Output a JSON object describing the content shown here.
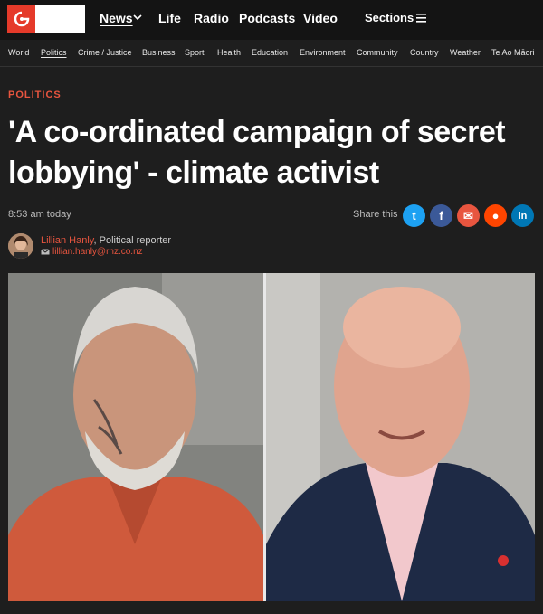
{
  "nav": {
    "items": [
      {
        "label": "News"
      },
      {
        "label": "Life"
      },
      {
        "label": "Radio"
      },
      {
        "label": "Podcasts"
      },
      {
        "label": "Video"
      }
    ],
    "sections_label": "Sections"
  },
  "subnav": {
    "items": [
      "World",
      "Politics",
      "Crime / Justice",
      "Business",
      "Sport",
      "Health",
      "Education",
      "Environment",
      "Community",
      "Country",
      "Weather",
      "Te Ao Māori"
    ]
  },
  "article": {
    "kicker": "POLITICS",
    "headline": "'A co-ordinated campaign of secret lobbying' - climate activist",
    "time": "8:53 am today",
    "share_label": "Share this",
    "share_buttons": [
      {
        "icon": "twitter-icon",
        "glyph": "t",
        "color": "#1da1f2"
      },
      {
        "icon": "facebook-icon",
        "glyph": "f",
        "color": "#3b5998"
      },
      {
        "icon": "email-icon",
        "glyph": "✉",
        "color": "#e8553f"
      },
      {
        "icon": "reddit-icon",
        "glyph": "●",
        "color": "#ff4500"
      },
      {
        "icon": "linkedin-icon",
        "glyph": "in",
        "color": "#0077b5"
      }
    ],
    "author_name": "Lillian Hanly",
    "author_role": ", Political reporter",
    "author_email": "lillian.hanly@rnz.co.nz"
  },
  "colors": {
    "accent": "#e8553f",
    "background": "#1e1e1e",
    "topbar": "#141414"
  }
}
